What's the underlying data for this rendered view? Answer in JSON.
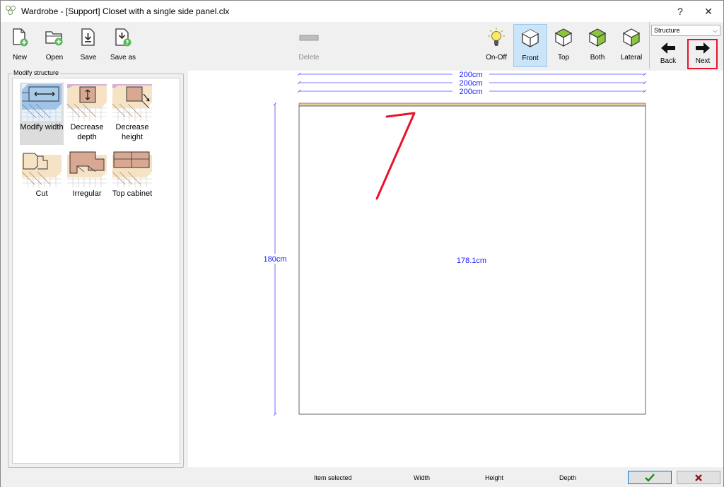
{
  "window": {
    "title": "Wardrobe - [Support] Closet with a single side panel.clx",
    "help_label": "?",
    "close_label": "✕"
  },
  "toolbar": {
    "new_label": "New",
    "open_label": "Open",
    "save_label": "Save",
    "save_as_label": "Save as",
    "delete_label": "Delete",
    "onoff_label": "On-Off",
    "front_label": "Front",
    "top_label": "Top",
    "both_label": "Both",
    "lateral_label": "Lateral",
    "back_label": "Back",
    "next_label": "Next",
    "mode_select": "Structure"
  },
  "panel": {
    "title": "Modify structure",
    "tools": [
      {
        "label": "Modify width"
      },
      {
        "label": "Decrease depth"
      },
      {
        "label": "Decrease height"
      },
      {
        "label": "Cut"
      },
      {
        "label": "Irregular"
      },
      {
        "label": "Top cabinet"
      }
    ]
  },
  "drawing": {
    "width_dim_1": "200cm",
    "width_dim_2": "200cm",
    "width_dim_3": "200cm",
    "height_dim": "180cm",
    "inner_height_dim": "178.1cm",
    "dim_color": "#1a1aff",
    "annotation_color": "#e8132b"
  },
  "status": {
    "item_selected_label": "Item selected",
    "width_label": "Width",
    "height_label": "Height",
    "depth_label": "Depth",
    "ok_icon": "check-icon",
    "cancel_icon": "x-icon"
  }
}
